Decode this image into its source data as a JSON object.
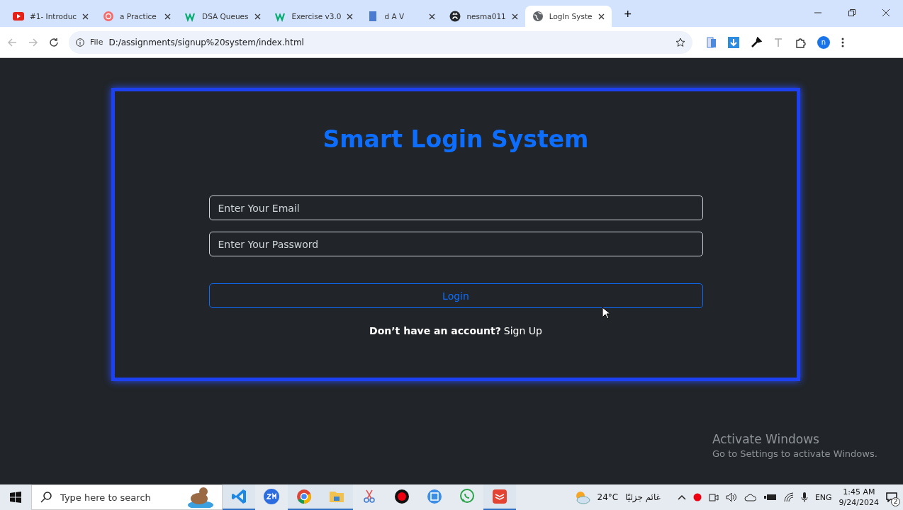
{
  "browser": {
    "tabs": [
      {
        "title": "#1- Introduc",
        "kind": "video",
        "selected": false
      },
      {
        "title": "a Practice",
        "kind": "circle",
        "selected": false
      },
      {
        "title": "DSA Queues",
        "kind": "w",
        "selected": false
      },
      {
        "title": "Exercise v3.0",
        "kind": "w",
        "selected": false
      },
      {
        "title": "d A V",
        "kind": "doc",
        "selected": false
      },
      {
        "title": "nesma011",
        "kind": "github",
        "selected": false
      },
      {
        "title": "LogIn Syste",
        "kind": "globe",
        "selected": true
      }
    ],
    "new_tab": "+",
    "scheme": "File",
    "url": "D:/assignments/signup%20system/index.html",
    "profile": "n"
  },
  "page": {
    "title": "Smart Login System",
    "email": {
      "placeholder": "Enter Your Email"
    },
    "password": {
      "placeholder": "Enter Your Password"
    },
    "login": "Login",
    "prompt": "Don’t have an account?",
    "signup": "Sign Up"
  },
  "activation": {
    "title": "Activate Windows",
    "subtitle": "Go to Settings to activate Windows."
  },
  "taskbar": {
    "search": {
      "placeholder": "Type here to search"
    },
    "apps": [
      {
        "kind": "vscode",
        "running": true
      },
      {
        "kind": "zoom",
        "running": false
      },
      {
        "kind": "chrome",
        "running": true
      },
      {
        "kind": "folder",
        "running": true
      },
      {
        "kind": "snip",
        "running": false
      },
      {
        "kind": "record",
        "running": false
      },
      {
        "kind": "save",
        "running": false
      },
      {
        "kind": "whatsapp",
        "running": false
      },
      {
        "kind": "todo",
        "running": true
      }
    ],
    "weather": {
      "temp": "24°C",
      "condition": "غائم جزئيًا"
    },
    "language": "ENG",
    "time": "1:45 AM",
    "date": "9/24/2024",
    "notifications": "2"
  }
}
